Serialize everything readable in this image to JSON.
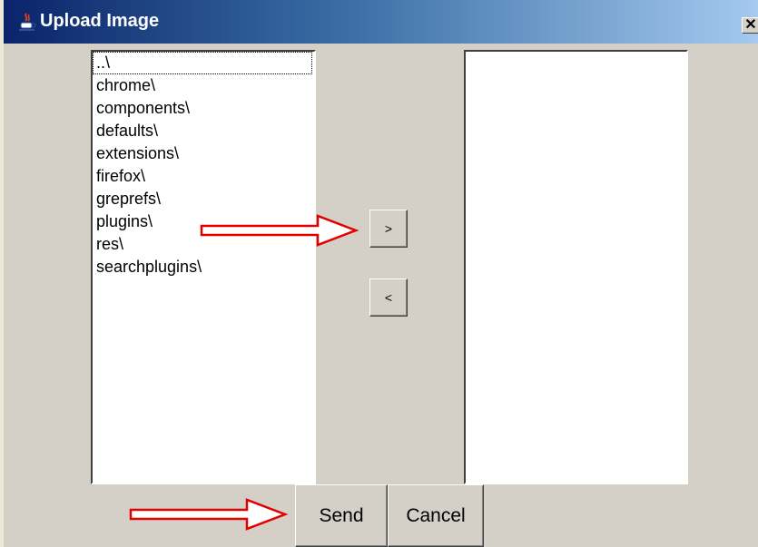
{
  "window": {
    "title": "Upload Image",
    "close_label": "✕",
    "app_icon": "java-coffee-cup-icon",
    "close_icon": "close-icon"
  },
  "left_list": {
    "items": [
      {
        "label": "..\\",
        "focused": true
      },
      {
        "label": "chrome\\"
      },
      {
        "label": "components\\"
      },
      {
        "label": "defaults\\"
      },
      {
        "label": "extensions\\"
      },
      {
        "label": "firefox\\"
      },
      {
        "label": "greprefs\\"
      },
      {
        "label": "plugins\\"
      },
      {
        "label": "res\\"
      },
      {
        "label": "searchplugins\\"
      }
    ]
  },
  "right_list": {
    "items": []
  },
  "buttons": {
    "move_right_label": ">",
    "move_left_label": "<",
    "send_label": "Send",
    "cancel_label": "Cancel"
  },
  "annotations": {
    "arrow_color": "#e00000",
    "arrow_icon": "right-arrow-annotation-icon"
  }
}
